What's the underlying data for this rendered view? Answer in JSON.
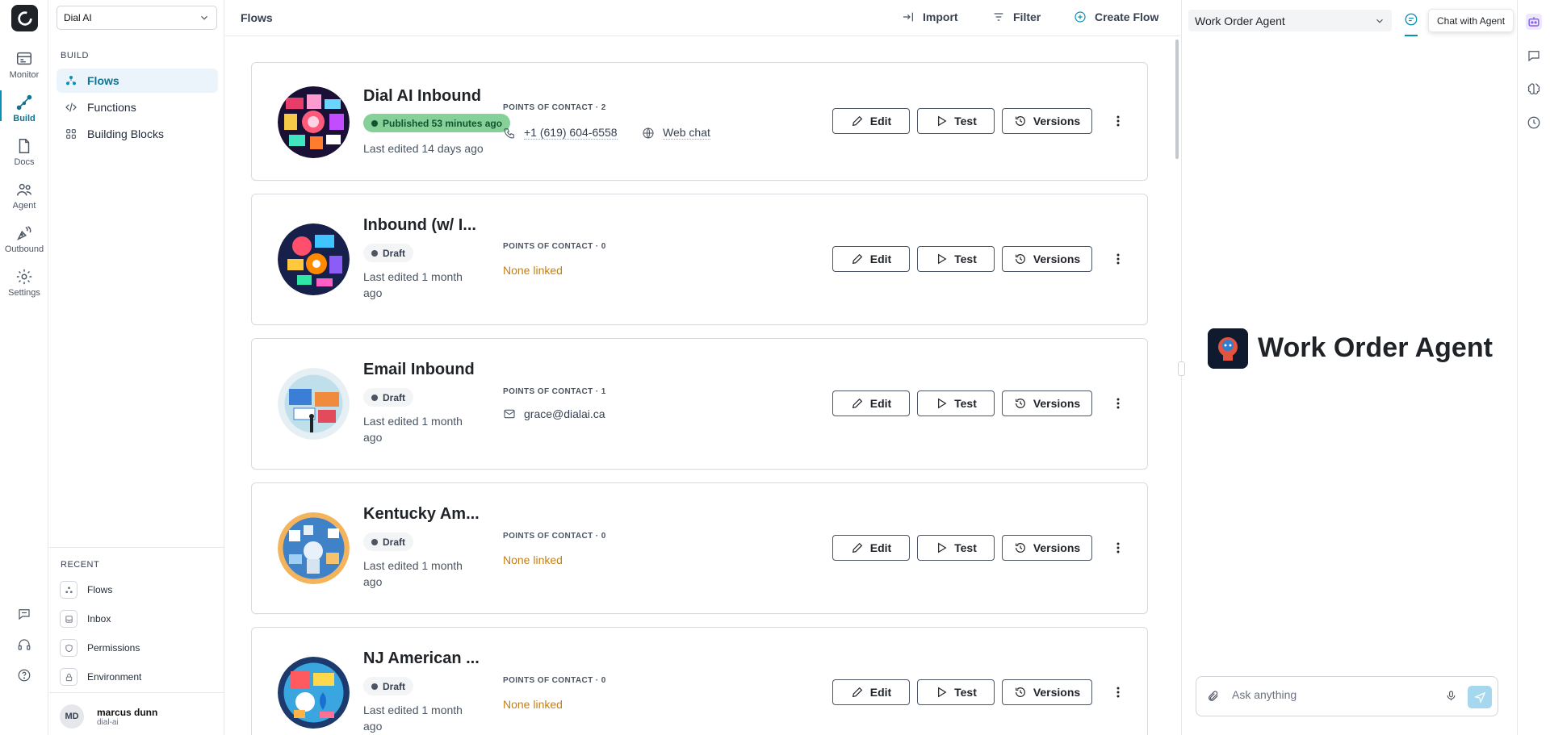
{
  "rail": {
    "items": [
      {
        "label": "Monitor",
        "icon": "monitor-icon"
      },
      {
        "label": "Build",
        "icon": "build-icon"
      },
      {
        "label": "Docs",
        "icon": "docs-icon"
      },
      {
        "label": "Agent",
        "icon": "agent-icon"
      },
      {
        "label": "Outbound",
        "icon": "outbound-icon"
      },
      {
        "label": "Settings",
        "icon": "gear-icon"
      }
    ],
    "active": "Build"
  },
  "sidebar": {
    "workspace": "Dial AI",
    "section_build": "BUILD",
    "nav": [
      {
        "label": "Flows",
        "active": true
      },
      {
        "label": "Functions",
        "active": false
      },
      {
        "label": "Building Blocks",
        "active": false
      }
    ],
    "section_recent": "RECENT",
    "recent": [
      {
        "label": "Flows"
      },
      {
        "label": "Inbox"
      },
      {
        "label": "Permissions"
      },
      {
        "label": "Environment"
      }
    ],
    "user": {
      "initials": "MD",
      "name": "marcus dunn",
      "org": "dial-ai"
    }
  },
  "main": {
    "title": "Flows",
    "actions": {
      "import": "Import",
      "filter": "Filter",
      "create": "Create Flow"
    },
    "flows": [
      {
        "title": "Dial AI Inbound",
        "status": "Published 53 minutes ago",
        "status_type": "published",
        "last_edited": "Last edited 14 days ago",
        "poc_label": "POINTS OF CONTACT · 2",
        "contacts": [
          {
            "type": "phone",
            "value": "+1 (619) 604-6558"
          },
          {
            "type": "web",
            "value": "Web chat"
          }
        ],
        "none_text": ""
      },
      {
        "title": "Inbound (w/ I...",
        "status": "Draft",
        "status_type": "draft",
        "last_edited": "Last edited 1 month ago",
        "poc_label": "POINTS OF CONTACT · 0",
        "contacts": [],
        "none_text": "None linked"
      },
      {
        "title": "Email Inbound",
        "status": "Draft",
        "status_type": "draft",
        "last_edited": "Last edited 1 month ago",
        "poc_label": "POINTS OF CONTACT · 1",
        "contacts": [
          {
            "type": "email",
            "value": "grace@dialai.ca"
          }
        ],
        "none_text": ""
      },
      {
        "title": "Kentucky Am...",
        "status": "Draft",
        "status_type": "draft",
        "last_edited": "Last edited 1 month ago",
        "poc_label": "POINTS OF CONTACT · 0",
        "contacts": [],
        "none_text": "None linked"
      },
      {
        "title": "NJ American ...",
        "status": "Draft",
        "status_type": "draft",
        "last_edited": "Last edited 1 month ago",
        "poc_label": "POINTS OF CONTACT · 0",
        "contacts": [],
        "none_text": "None linked"
      }
    ],
    "card_buttons": {
      "edit": "Edit",
      "test": "Test",
      "versions": "Versions"
    }
  },
  "panel": {
    "agent": "Work Order Agent",
    "tooltip": "Chat with Agent",
    "heading": "Work Order Agent",
    "input_placeholder": "Ask anything"
  },
  "colors": {
    "accent": "#0891b2",
    "published_bg": "#86d19a",
    "none_linked": "#c47f12"
  }
}
